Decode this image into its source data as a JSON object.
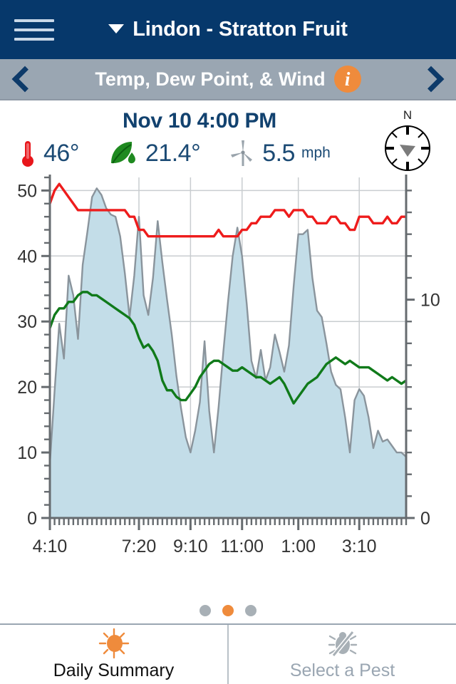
{
  "header": {
    "menu_icon": "hamburger-icon",
    "caret_icon": "caret-down-icon",
    "title": "Lindon - Stratton Fruit"
  },
  "subheader": {
    "prev_icon": "chevron-left-icon",
    "next_icon": "chevron-right-icon",
    "title": "Temp, Dew Point, & Wind",
    "info_label": "i"
  },
  "reading": {
    "timestamp": "Nov 10 4:00 PM",
    "temperature": {
      "icon": "thermometer-icon",
      "value": "46°"
    },
    "dewpoint": {
      "icon": "leaf-dew-icon",
      "value": "21.4°"
    },
    "wind": {
      "icon": "wind-turbine-icon",
      "value": "5.5",
      "unit": "mph"
    },
    "compass": {
      "icon": "compass-icon",
      "north_label": "N",
      "direction_deg": 160
    }
  },
  "pager": {
    "count": 3,
    "active_index": 1
  },
  "tabs": [
    {
      "label": "Daily Summary",
      "icon": "sun-icon",
      "active": true
    },
    {
      "label": "Select a Pest",
      "icon": "pest-bug-icon",
      "active": false
    }
  ],
  "chart_data": {
    "type": "line",
    "title": "",
    "xlabel": "",
    "ylabel": "",
    "grid": true,
    "legend": "none",
    "x_tick_labels": [
      "4:10",
      "7:20",
      "9:10",
      "11:00",
      "1:00",
      "3:10"
    ],
    "x_tick_positions": [
      0,
      19,
      30,
      41,
      53,
      66
    ],
    "n_points": 77,
    "left_axis": {
      "label": "",
      "ylim": [
        0,
        52
      ],
      "ticks": [
        0,
        10,
        20,
        30,
        40,
        50
      ],
      "unit": "°F"
    },
    "right_axis": {
      "label": "",
      "ylim": [
        0,
        15.6
      ],
      "ticks": [
        0,
        10
      ],
      "unit": "mph"
    },
    "colors": {
      "temperature": "#ee1c1c",
      "dewpoint": "#107a1a",
      "wind_line": "#8a949c",
      "wind_fill": "#c3dde8",
      "grid": "#c9cdd0",
      "axis": "#666b6f"
    },
    "series": [
      {
        "name": "Temperature",
        "axis": "left",
        "color": "#ee1c1c",
        "unit": "°F",
        "values": [
          48,
          50,
          51,
          50,
          49,
          48,
          47,
          47,
          47,
          47,
          47,
          47,
          47,
          47,
          47,
          47,
          47,
          46,
          46,
          44,
          44,
          43,
          43,
          43,
          43,
          43,
          43,
          43,
          43,
          43,
          43,
          43,
          43,
          43,
          43,
          43,
          44,
          43,
          43,
          43,
          43,
          44,
          44,
          45,
          45,
          46,
          46,
          46,
          47,
          47,
          47,
          46,
          47,
          47,
          47,
          46,
          46,
          45,
          45,
          45,
          46,
          46,
          45,
          45,
          44,
          44,
          46,
          46,
          46,
          45,
          45,
          45,
          46,
          45,
          45,
          46,
          46
        ]
      },
      {
        "name": "Dew Point",
        "axis": "left",
        "color": "#107a1a",
        "unit": "°F",
        "values": [
          29,
          31,
          32,
          32,
          33,
          33,
          34,
          34.5,
          34.5,
          34,
          34,
          33.5,
          33,
          32.5,
          32,
          31.5,
          31,
          30.5,
          29.5,
          27.5,
          26,
          26.5,
          25.5,
          24,
          21,
          19.5,
          19.5,
          18.5,
          18,
          18,
          19,
          20,
          21.5,
          22.5,
          23.5,
          24,
          24,
          23.5,
          23,
          22.5,
          22.5,
          23,
          22.5,
          22,
          21.5,
          21.5,
          21,
          20.5,
          21,
          21.5,
          20.5,
          19,
          17.5,
          18.5,
          19.5,
          20.5,
          21,
          21.5,
          22.5,
          23.5,
          24,
          24.5,
          24,
          23.5,
          24,
          23.5,
          23,
          23,
          23,
          22.5,
          22,
          21.5,
          21,
          21.5,
          21,
          20.5,
          21
        ]
      },
      {
        "name": "Wind Speed",
        "axis": "right",
        "color": "#8a949c",
        "fill": "#c3dde8",
        "unit": "mph",
        "values": [
          2.5,
          5.8,
          8.9,
          7.3,
          11.1,
          10.2,
          8.2,
          11.6,
          13.1,
          14.7,
          15.1,
          14.8,
          14.2,
          13.9,
          13.8,
          12.9,
          11.2,
          9.2,
          11.1,
          13.8,
          10.2,
          9.3,
          11.0,
          13.6,
          11.7,
          10.0,
          8.4,
          6.5,
          5.0,
          3.7,
          3.0,
          4.0,
          5.3,
          8.1,
          4.9,
          3.0,
          5.1,
          7.6,
          9.9,
          12.0,
          13.3,
          12.0,
          9.8,
          7.2,
          6.4,
          7.7,
          6.3,
          6.9,
          8.4,
          7.6,
          6.7,
          7.9,
          10.6,
          13.0,
          13.0,
          13.2,
          11.0,
          9.5,
          9.2,
          8.0,
          6.7,
          6.1,
          5.9,
          4.6,
          3.0,
          5.4,
          5.9,
          5.6,
          4.6,
          3.2,
          4.0,
          3.5,
          3.6,
          3.3,
          3.0,
          3.0,
          2.8
        ]
      }
    ]
  }
}
